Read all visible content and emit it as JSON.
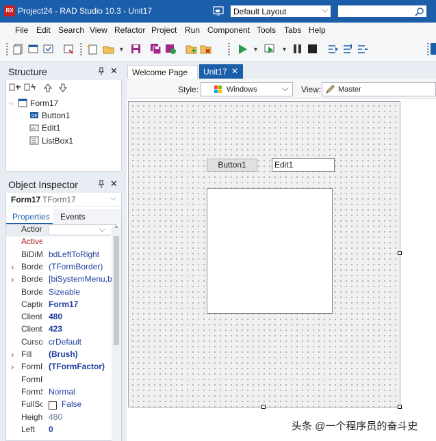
{
  "titlebar": {
    "app_icon_text": "RX",
    "title": "Project24 - RAD Studio 10.3 - Unit17",
    "layout_combo": "Default Layout",
    "search_value": ""
  },
  "menu": [
    "File",
    "Edit",
    "Search",
    "View",
    "Refactor",
    "Project",
    "Run",
    "Component",
    "Tools",
    "Tabs",
    "Help"
  ],
  "structure": {
    "title": "Structure",
    "pin_glyph": "📌",
    "close_glyph": "✕",
    "tree": {
      "root": "Form17",
      "children": [
        "Button1",
        "Edit1",
        "ListBox1"
      ]
    }
  },
  "object_inspector": {
    "title": "Object Inspector",
    "selected_name": "Form17",
    "selected_type": "TForm17",
    "tabs": [
      "Properties",
      "Events"
    ],
    "rows": [
      {
        "name": "Actior",
        "value": ""
      },
      {
        "name": "Active",
        "value": ""
      },
      {
        "name": "BiDiM",
        "value": "bdLeftToRight"
      },
      {
        "name": "Borde",
        "value": "(TFormBorder)"
      },
      {
        "name": "Borde",
        "value": "[biSystemMenu,bil"
      },
      {
        "name": "Borde",
        "value": "Sizeable"
      },
      {
        "name": "Captic",
        "value": "Form17"
      },
      {
        "name": "Client",
        "value": "480"
      },
      {
        "name": "Client",
        "value": "423"
      },
      {
        "name": "Curso",
        "value": "crDefault"
      },
      {
        "name": "Fill",
        "value": "(Brush)"
      },
      {
        "name": "FormF",
        "value": "(TFormFactor)"
      },
      {
        "name": "FormF",
        "value": ""
      },
      {
        "name": "FormS",
        "value": "Normal"
      },
      {
        "name": "FullSc",
        "value": "False"
      },
      {
        "name": "Heigh",
        "value": "480"
      },
      {
        "name": "Left",
        "value": "0"
      }
    ]
  },
  "editor": {
    "tabs": [
      "Welcome Page",
      "Unit17"
    ],
    "active_tab": "Unit17",
    "style_label": "Style:",
    "style_value": "Windows",
    "view_label": "View:",
    "view_value": "Master"
  },
  "form": {
    "button_caption": "Button1",
    "edit_text": "Edit1"
  },
  "watermark": "头条 @一个程序员的奋斗史",
  "colors": {
    "titlebar": "#1b5ea9",
    "active_tab": "#1b5ea9",
    "oi_tab_accent": "#1b5ea9",
    "property_value": "#1f3f9f",
    "highlighted_property": "#b11c1c"
  }
}
